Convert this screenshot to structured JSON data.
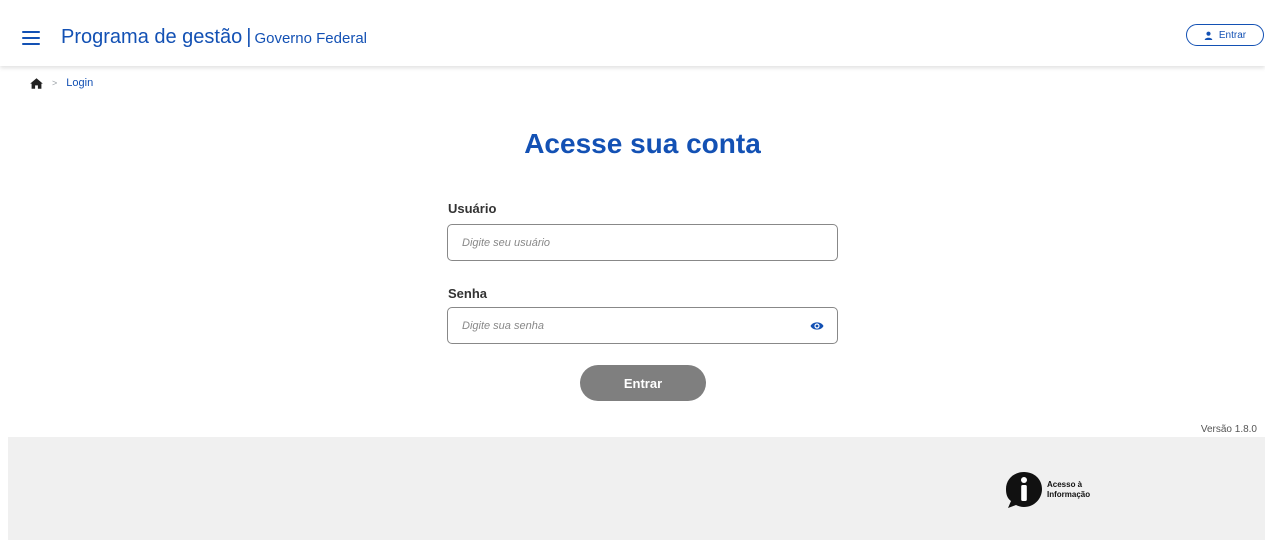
{
  "header": {
    "title": "Programa de gestão",
    "separator": "|",
    "subtitle": "Governo Federal",
    "login_button": {
      "label": "Entrar",
      "icon": "user-icon"
    },
    "menu_icon": "hamburger-menu-icon"
  },
  "breadcrumb": {
    "home_icon": "home-icon",
    "separator": ">",
    "items": [
      {
        "label": "Login"
      }
    ]
  },
  "main": {
    "title": "Acesse sua conta",
    "username": {
      "label": "Usuário",
      "placeholder": "Digite seu usuário",
      "value": ""
    },
    "password": {
      "label": "Senha",
      "placeholder": "Digite sua senha",
      "value": "",
      "toggle_icon": "eye-icon"
    },
    "submit_label": "Entrar"
  },
  "version": "Versão 1.8.0",
  "footer": {
    "access_info": {
      "line1": "Acesso à",
      "line2": "Informação",
      "icon": "information-icon"
    }
  },
  "colors": {
    "primary": "#1351b4",
    "button_disabled": "#7f7f7f",
    "footer_bg": "#f0f0f0"
  }
}
